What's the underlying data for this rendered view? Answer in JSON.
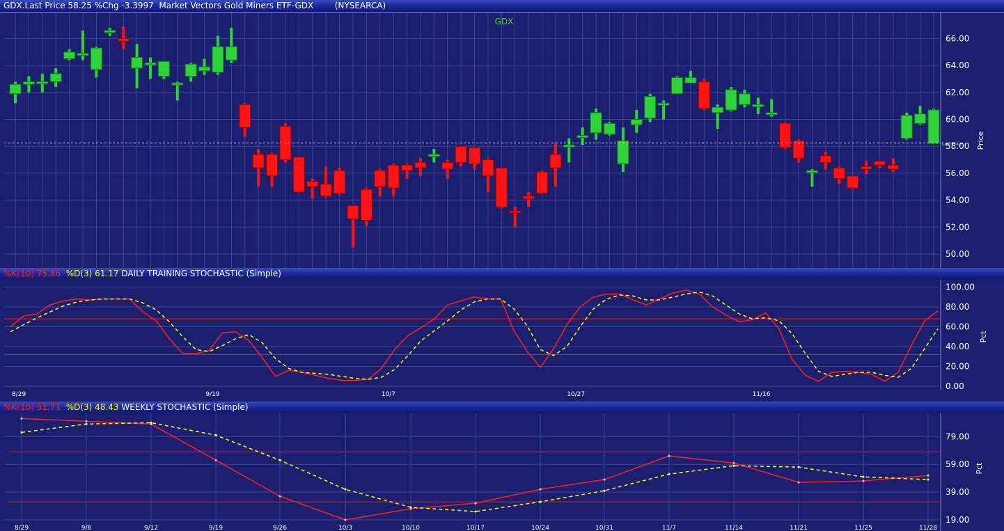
{
  "header": {
    "text": "GDX.Last Price 58.25 %Chg -3.3997  Market Vectors Gold Miners ETF-GDX        (NYSEARCA)"
  },
  "colors": {
    "background": "#1c1f6e",
    "up": "#2fd23a",
    "down": "#ff1414",
    "k_line": "#ff2020",
    "d_line": "#ffff00",
    "grid": "#3c44a0",
    "band": "#ff1414"
  },
  "price_panel": {
    "symbol": "GDX",
    "ylabel": "Price",
    "last_label": "Last Price",
    "yticks": [
      "66.00",
      "64.00",
      "62.00",
      "60.00",
      "58.00",
      "56.00",
      "54.00",
      "52.00",
      "50.00"
    ]
  },
  "daily_panel": {
    "legend_k": "%K(10) 75.86",
    "legend_d": "%D(3) 61.17",
    "legend_name": " DAILY TRAINING STOCHASTIC (Simple)",
    "ylabel": "Pct",
    "yticks": [
      "100.00",
      "80.00",
      "60.00",
      "40.00",
      "20.00",
      "0.00"
    ],
    "xticks": [
      "8/29",
      "9/19",
      "10/7",
      "10/27",
      "11/16"
    ]
  },
  "weekly_panel": {
    "legend_k": "%K(10) 51.71",
    "legend_d": "%D(3) 48.43",
    "legend_name": " WEEKLY STOCHASTIC (Simple)",
    "ylabel": "Pct",
    "yticks": [
      "79.00",
      "59.00",
      "39.00",
      "19.00"
    ],
    "xticks": [
      "8/29",
      "9/6",
      "9/12",
      "9/19",
      "9/26",
      "10/3",
      "10/10",
      "10/17",
      "10/24",
      "10/31",
      "11/7",
      "11/14",
      "11/21",
      "11/25",
      "11/28"
    ]
  },
  "chart_data": [
    {
      "type": "candlestick",
      "title": "GDX",
      "ylabel": "Price",
      "ylim": [
        50,
        67
      ],
      "last_price": 58.25,
      "candles": [
        {
          "o": 61.9,
          "h": 62.8,
          "l": 61.2,
          "c": 62.6
        },
        {
          "o": 62.6,
          "h": 63.2,
          "l": 62.0,
          "c": 62.8
        },
        {
          "o": 62.7,
          "h": 63.4,
          "l": 62.0,
          "c": 62.8
        },
        {
          "o": 62.8,
          "h": 63.8,
          "l": 62.4,
          "c": 63.4
        },
        {
          "o": 64.5,
          "h": 65.2,
          "l": 64.4,
          "c": 65.0
        },
        {
          "o": 64.9,
          "h": 66.6,
          "l": 64.4,
          "c": 64.9
        },
        {
          "o": 63.7,
          "h": 65.4,
          "l": 63.1,
          "c": 65.3
        },
        {
          "o": 66.6,
          "h": 66.8,
          "l": 66.2,
          "c": 66.6
        },
        {
          "o": 66.0,
          "h": 66.9,
          "l": 65.2,
          "c": 65.8
        },
        {
          "o": 63.8,
          "h": 65.6,
          "l": 62.3,
          "c": 64.6
        },
        {
          "o": 64.2,
          "h": 64.6,
          "l": 63.0,
          "c": 64.2
        },
        {
          "o": 63.2,
          "h": 64.3,
          "l": 63.0,
          "c": 64.3
        },
        {
          "o": 62.7,
          "h": 62.8,
          "l": 61.4,
          "c": 62.7
        },
        {
          "o": 63.2,
          "h": 64.2,
          "l": 62.8,
          "c": 64.1
        },
        {
          "o": 63.6,
          "h": 64.5,
          "l": 63.3,
          "c": 63.9
        },
        {
          "o": 63.5,
          "h": 66.2,
          "l": 63.3,
          "c": 65.4
        },
        {
          "o": 64.4,
          "h": 66.8,
          "l": 64.2,
          "c": 65.4
        },
        {
          "o": 61.1,
          "h": 61.2,
          "l": 58.7,
          "c": 59.4
        },
        {
          "o": 57.4,
          "h": 57.8,
          "l": 55.0,
          "c": 56.4
        },
        {
          "o": 57.4,
          "h": 57.5,
          "l": 55.0,
          "c": 55.8
        },
        {
          "o": 59.5,
          "h": 59.7,
          "l": 56.8,
          "c": 57.0
        },
        {
          "o": 57.2,
          "h": 57.2,
          "l": 54.6,
          "c": 54.6
        },
        {
          "o": 55.4,
          "h": 55.6,
          "l": 54.1,
          "c": 55.0
        },
        {
          "o": 55.2,
          "h": 56.5,
          "l": 54.2,
          "c": 54.3
        },
        {
          "o": 56.2,
          "h": 56.4,
          "l": 54.4,
          "c": 54.5
        },
        {
          "o": 53.6,
          "h": 53.6,
          "l": 50.5,
          "c": 52.6
        },
        {
          "o": 54.8,
          "h": 54.9,
          "l": 52.1,
          "c": 52.5
        },
        {
          "o": 56.2,
          "h": 56.3,
          "l": 54.3,
          "c": 55.0
        },
        {
          "o": 56.6,
          "h": 56.7,
          "l": 54.3,
          "c": 54.9
        },
        {
          "o": 56.6,
          "h": 56.7,
          "l": 55.6,
          "c": 56.2
        },
        {
          "o": 56.8,
          "h": 57.1,
          "l": 55.8,
          "c": 56.4
        },
        {
          "o": 57.4,
          "h": 57.8,
          "l": 56.8,
          "c": 57.4
        },
        {
          "o": 56.8,
          "h": 57.0,
          "l": 55.6,
          "c": 56.3
        },
        {
          "o": 58.0,
          "h": 58.0,
          "l": 56.5,
          "c": 56.8
        },
        {
          "o": 57.9,
          "h": 57.9,
          "l": 56.3,
          "c": 56.7
        },
        {
          "o": 57.0,
          "h": 57.1,
          "l": 54.6,
          "c": 55.8
        },
        {
          "o": 56.4,
          "h": 56.4,
          "l": 53.4,
          "c": 53.5
        },
        {
          "o": 53.2,
          "h": 53.5,
          "l": 52.0,
          "c": 53.1
        },
        {
          "o": 54.3,
          "h": 54.6,
          "l": 53.5,
          "c": 54.1
        },
        {
          "o": 56.1,
          "h": 56.2,
          "l": 54.5,
          "c": 54.5
        },
        {
          "o": 57.4,
          "h": 58.2,
          "l": 55.0,
          "c": 56.4
        },
        {
          "o": 58.1,
          "h": 58.6,
          "l": 56.8,
          "c": 58.1
        },
        {
          "o": 58.8,
          "h": 59.4,
          "l": 58.1,
          "c": 58.8
        },
        {
          "o": 59.0,
          "h": 60.8,
          "l": 58.5,
          "c": 60.5
        },
        {
          "o": 58.9,
          "h": 59.8,
          "l": 58.8,
          "c": 59.7
        },
        {
          "o": 56.7,
          "h": 59.4,
          "l": 56.1,
          "c": 58.4
        },
        {
          "o": 59.6,
          "h": 60.7,
          "l": 59.0,
          "c": 60.0
        },
        {
          "o": 60.1,
          "h": 61.9,
          "l": 59.8,
          "c": 61.7
        },
        {
          "o": 61.2,
          "h": 61.4,
          "l": 60.0,
          "c": 61.2
        },
        {
          "o": 61.9,
          "h": 63.2,
          "l": 61.9,
          "c": 63.1
        },
        {
          "o": 62.7,
          "h": 63.6,
          "l": 62.7,
          "c": 63.1
        },
        {
          "o": 62.8,
          "h": 63.0,
          "l": 60.7,
          "c": 60.8
        },
        {
          "o": 60.5,
          "h": 61.1,
          "l": 59.3,
          "c": 60.9
        },
        {
          "o": 60.7,
          "h": 62.4,
          "l": 60.6,
          "c": 62.2
        },
        {
          "o": 61.1,
          "h": 62.2,
          "l": 60.9,
          "c": 61.9
        },
        {
          "o": 61.1,
          "h": 61.6,
          "l": 60.4,
          "c": 61.1
        },
        {
          "o": 60.4,
          "h": 61.5,
          "l": 60.2,
          "c": 60.5
        },
        {
          "o": 59.7,
          "h": 59.8,
          "l": 57.8,
          "c": 57.9
        },
        {
          "o": 58.4,
          "h": 58.5,
          "l": 56.8,
          "c": 57.1
        },
        {
          "o": 56.2,
          "h": 56.3,
          "l": 55.0,
          "c": 56.2
        },
        {
          "o": 57.3,
          "h": 57.6,
          "l": 56.3,
          "c": 56.8
        },
        {
          "o": 56.4,
          "h": 56.5,
          "l": 55.2,
          "c": 55.6
        },
        {
          "o": 55.8,
          "h": 55.8,
          "l": 54.9,
          "c": 54.9
        },
        {
          "o": 56.5,
          "h": 56.9,
          "l": 55.9,
          "c": 56.3
        },
        {
          "o": 56.9,
          "h": 56.9,
          "l": 56.4,
          "c": 56.6
        },
        {
          "o": 56.6,
          "h": 57.1,
          "l": 56.1,
          "c": 56.3
        },
        {
          "o": 58.6,
          "h": 60.5,
          "l": 58.5,
          "c": 60.3
        },
        {
          "o": 59.7,
          "h": 61.0,
          "l": 59.6,
          "c": 60.4
        },
        {
          "o": 58.2,
          "h": 60.8,
          "l": 58.2,
          "c": 60.7
        }
      ]
    },
    {
      "type": "line",
      "title": "DAILY TRAINING STOCHASTIC (Simple)",
      "ylabel": "Pct",
      "ylim": [
        0,
        100
      ],
      "bands": [
        68,
        32
      ],
      "series": [
        {
          "name": "%K(10)",
          "values": [
            60,
            71,
            73,
            82,
            86,
            88,
            87,
            88,
            88,
            88,
            75,
            66,
            48,
            33,
            33,
            36,
            54,
            55,
            46,
            29,
            10,
            16,
            14,
            11,
            8,
            6,
            6,
            7,
            18,
            37,
            51,
            59,
            68,
            82,
            86,
            90,
            88,
            88,
            56,
            35,
            19,
            38,
            62,
            80,
            90,
            93,
            93,
            87,
            82,
            88,
            94,
            97,
            93,
            80,
            72,
            65,
            67,
            74,
            58,
            27,
            11,
            5,
            14,
            15,
            14,
            12,
            5,
            14,
            41,
            66,
            76
          ]
        },
        {
          "name": "%D(3)",
          "values": [
            55,
            62,
            69,
            75,
            81,
            85,
            87,
            88,
            88,
            88,
            84,
            77,
            65,
            50,
            37,
            35,
            41,
            48,
            52,
            44,
            28,
            18,
            14,
            13,
            12,
            10,
            8,
            7,
            9,
            17,
            31,
            46,
            56,
            66,
            77,
            85,
            88,
            88,
            78,
            61,
            37,
            31,
            40,
            60,
            78,
            88,
            92,
            91,
            87,
            87,
            90,
            93,
            95,
            91,
            82,
            73,
            68,
            69,
            66,
            53,
            33,
            15,
            10,
            12,
            14,
            14,
            11,
            9,
            18,
            38,
            58
          ]
        }
      ]
    },
    {
      "type": "line",
      "title": "WEEKLY STOCHASTIC (Simple)",
      "ylabel": "Pct",
      "ylim": [
        19,
        93
      ],
      "bands": [
        68,
        32
      ],
      "categories": [
        "8/29",
        "9/6",
        "9/12",
        "9/19",
        "9/26",
        "10/3",
        "10/10",
        "10/17",
        "10/24",
        "10/31",
        "11/7",
        "11/14",
        "11/21",
        "11/25",
        "11/28"
      ],
      "series": [
        {
          "name": "%K(10)",
          "values": [
            92,
            90,
            88,
            62,
            36,
            19,
            27,
            31,
            41,
            48,
            65,
            60,
            46,
            47,
            51
          ]
        },
        {
          "name": "%D(3)",
          "values": [
            82,
            88,
            89,
            80,
            62,
            41,
            28,
            25,
            32,
            40,
            52,
            58,
            57,
            50,
            48
          ]
        }
      ]
    }
  ]
}
